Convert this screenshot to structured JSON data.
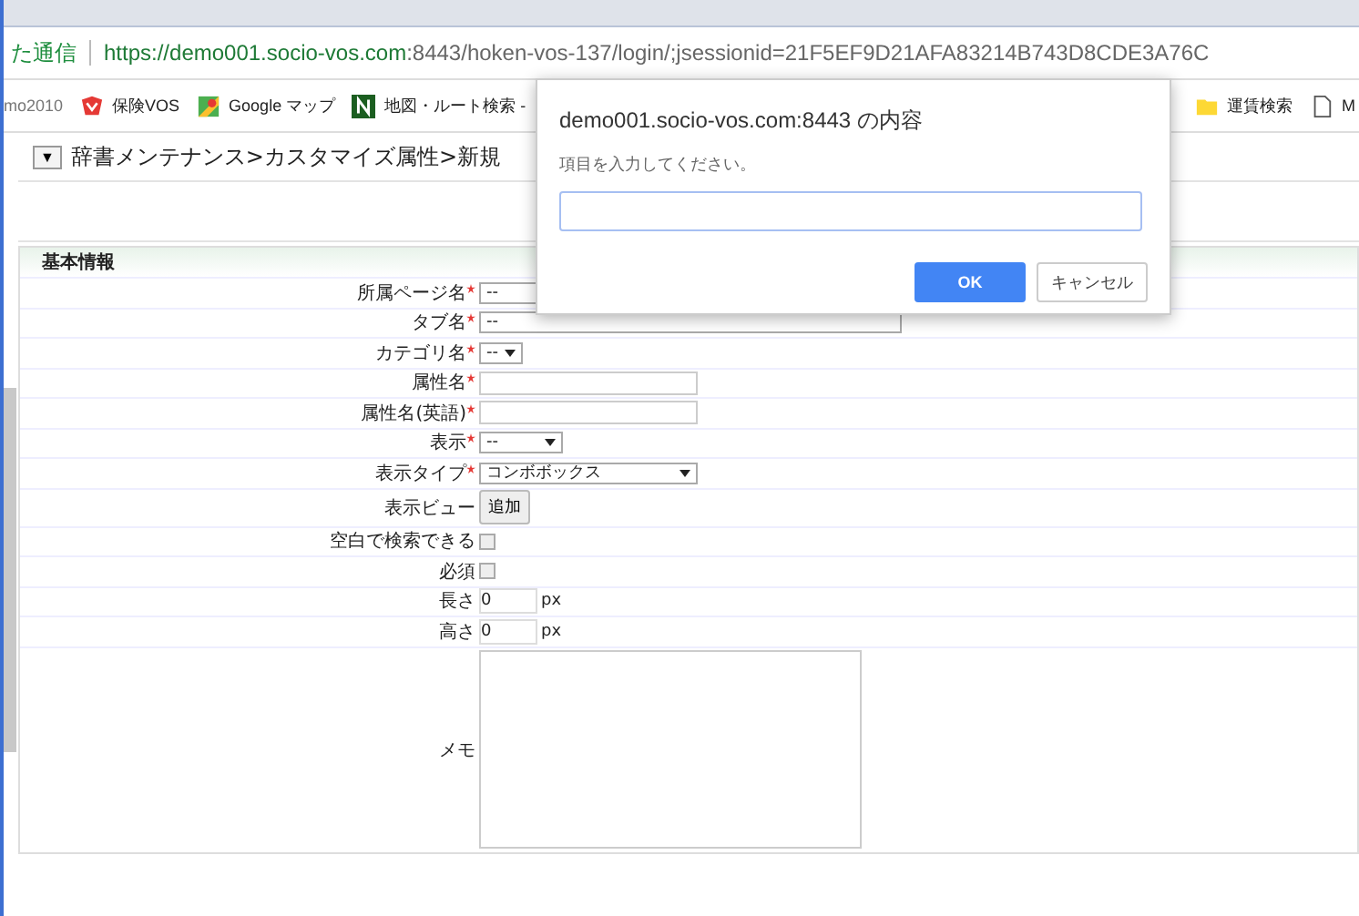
{
  "browser": {
    "security": "た通信",
    "url_host": "https://demo001.socio-vos.com",
    "url_rest": ":8443/hoken-vos-137/login/;jsessionid=21F5EF9D21AFA83214B743D8CDE3A76C",
    "bookmarks": [
      {
        "label": "mo2010"
      },
      {
        "label": "保険VOS"
      },
      {
        "label": "Google マップ"
      },
      {
        "label": "地図・ルート検索 -"
      },
      {
        "label": "運賃検索"
      },
      {
        "label": "M"
      }
    ]
  },
  "breadcrumb": {
    "toggle": "▼",
    "text": "辞書メンテナンス>カスタマイズ属性>新規"
  },
  "form": {
    "section": "基本情報",
    "rows": [
      {
        "label": "所属ページ名",
        "required": true,
        "kind": "select",
        "value": "--"
      },
      {
        "label": "タブ名",
        "required": true,
        "kind": "select",
        "value": "--"
      },
      {
        "label": "カテゴリ名",
        "required": true,
        "kind": "small-select",
        "value": "--"
      },
      {
        "label": "属性名",
        "required": true,
        "kind": "text"
      },
      {
        "label": "属性名(英語)",
        "required": true,
        "kind": "text"
      },
      {
        "label": "表示",
        "required": true,
        "kind": "mid-select",
        "value": "--"
      },
      {
        "label": "表示タイプ",
        "required": true,
        "kind": "type-select",
        "value": "コンボボックス"
      },
      {
        "label": "表示ビュー",
        "required": false,
        "kind": "button",
        "value": "追加"
      },
      {
        "label": "空白で検索できる",
        "required": false,
        "kind": "checkbox",
        "checked": false
      },
      {
        "label": "必須",
        "required": false,
        "kind": "checkbox",
        "checked": false
      },
      {
        "label": "長さ",
        "required": false,
        "kind": "number",
        "value": "0",
        "unit": "px"
      },
      {
        "label": "高さ",
        "required": false,
        "kind": "number",
        "value": "0",
        "unit": "px"
      },
      {
        "label": "メモ",
        "required": false,
        "kind": "textarea"
      }
    ]
  },
  "dialog": {
    "title": "demo001.socio-vos.com:8443 の内容",
    "message": "項目を入力してください。",
    "buttons": [
      {
        "label": "OK",
        "primary": true
      },
      {
        "label": "キャンセル",
        "primary": false
      }
    ]
  }
}
